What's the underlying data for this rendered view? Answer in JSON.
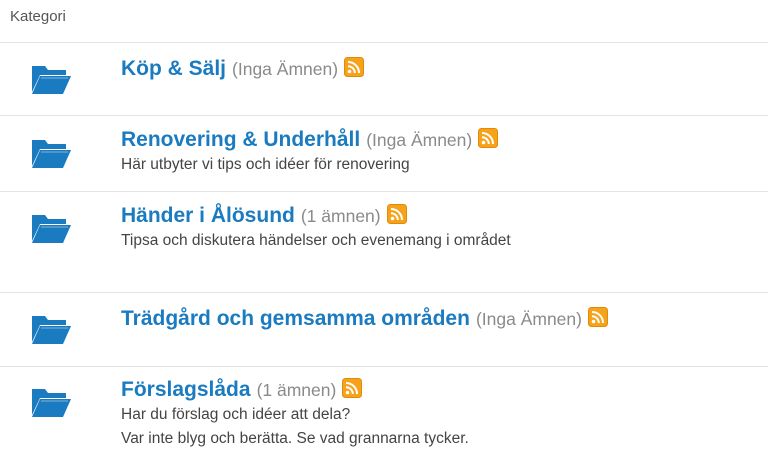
{
  "header": {
    "label": "Kategori"
  },
  "categories": [
    {
      "title": "Köp & Sälj",
      "count": "(Inga Ämnen)",
      "desc": []
    },
    {
      "title": "Renovering & Underhåll",
      "count": "(Inga Ämnen)",
      "desc": [
        "Här utbyter vi tips och idéer för renovering"
      ]
    },
    {
      "title": "Händer i Ålösund",
      "count": "(1 ämnen)",
      "desc": [
        "Tipsa och diskutera händelser och evenemang i området"
      ]
    },
    {
      "title": "Trädgård och gemsamma områden",
      "count": "(Inga Ämnen)",
      "desc": []
    },
    {
      "title": "Förslagslåda",
      "count": "(1 ämnen)",
      "desc": [
        "Har du förslag och idéer att dela?",
        "Var inte blyg och berätta. Se vad grannarna tycker."
      ]
    }
  ],
  "icons": {
    "folder": "folder-icon",
    "rss": "rss-icon"
  },
  "colors": {
    "link": "#1a7bc1",
    "folder": "#1a7bc1",
    "rss": "#f7a21b",
    "muted": "#8a8a8a"
  }
}
